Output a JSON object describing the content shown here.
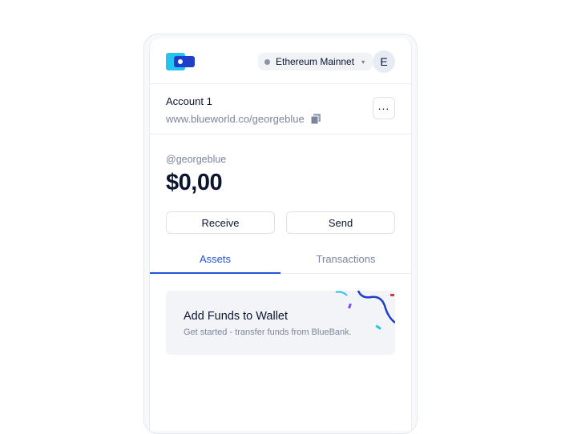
{
  "header": {
    "logo": "wallet-logo-icon",
    "network": {
      "label": "Ethereum Mainnet",
      "icon": "chevron-down-icon"
    },
    "avatar_initial": "E"
  },
  "account": {
    "name": "Account 1",
    "url": "www.blueworld.co/georgeblue",
    "copy_icon": "copy-icon",
    "more_icon": "more-horizontal-icon",
    "more_glyph": "..."
  },
  "wallet": {
    "username": "@georgeblue",
    "balance": "$0,00",
    "receive_label": "Receive",
    "send_label": "Send"
  },
  "tabs": [
    {
      "label": "Assets",
      "active": true
    },
    {
      "label": "Transactions",
      "active": false
    }
  ],
  "add_funds": {
    "title": "Add Funds to Wallet",
    "subtitle": "Get started - transfer funds from BlueBank."
  },
  "colors": {
    "accent": "#2454d6",
    "logo_blue": "#1e40c8",
    "logo_cyan": "#27c3f0",
    "text_primary": "#0b1530",
    "text_muted": "#7c859b"
  }
}
